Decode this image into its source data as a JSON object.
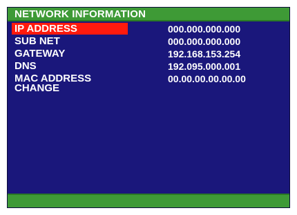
{
  "title": "NETWORK INFORMATION",
  "colors": {
    "background": "#1a177b",
    "bar": "#3e9a36",
    "selected": "#ff1a0d",
    "text": "#ffffff"
  },
  "rows": [
    {
      "label": "IP ADDRESS",
      "value": "000.000.000.000",
      "selected": true
    },
    {
      "label": "SUB NET",
      "value": "000.000.000.000",
      "selected": false
    },
    {
      "label": "GATEWAY",
      "value": "192.168.153.254",
      "selected": false
    },
    {
      "label": "DNS",
      "value": "192.095.000.001",
      "selected": false
    },
    {
      "label_line1": "MAC ADDRESS",
      "label_line2": "CHANGE",
      "value": "00.00.00.00.00.00",
      "selected": false
    }
  ]
}
